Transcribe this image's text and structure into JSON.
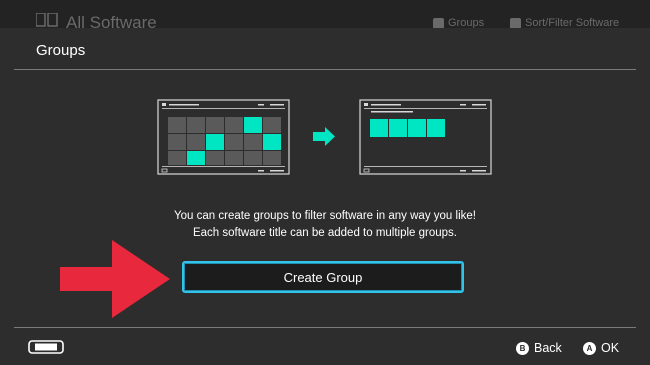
{
  "background": {
    "title": "All Software",
    "hints": [
      {
        "key_icon": "l-key-icon",
        "label": "Groups"
      },
      {
        "key_icon": "r-key-icon",
        "label": "Sort/Filter Software"
      }
    ]
  },
  "dialog": {
    "title": "Groups",
    "description_line1": "You can create groups to filter software in any way you like!",
    "description_line2": "Each software title can be added to multiple groups.",
    "create_button_label": "Create Group"
  },
  "footer": {
    "controller_icon": "handheld-console-icon",
    "back": {
      "glyph": "B",
      "label": "Back"
    },
    "ok": {
      "glyph": "A",
      "label": "OK"
    }
  },
  "colors": {
    "accent": "#33c2e8",
    "tile_highlight": "#00e6c3",
    "arrow": "#e8283c",
    "background": "#2d2d2d"
  }
}
